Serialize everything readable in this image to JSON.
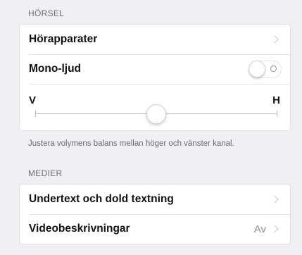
{
  "hearing": {
    "header": "HÖRSEL",
    "hearing_aids_label": "Hörapparater",
    "mono_audio_label": "Mono-ljud",
    "mono_audio_on": false,
    "balance_left_label": "V",
    "balance_right_label": "H",
    "balance_value": 0.5,
    "footer": "Justera volymens balans mellan höger och vänster kanal."
  },
  "media": {
    "header": "MEDIER",
    "subtitles_label": "Undertext och dold textning",
    "audio_descriptions_label": "Videobeskrivningar",
    "audio_descriptions_value": "Av"
  },
  "icons": {
    "chevron": "chevron-right-icon",
    "toggle_off": "circle-icon"
  }
}
